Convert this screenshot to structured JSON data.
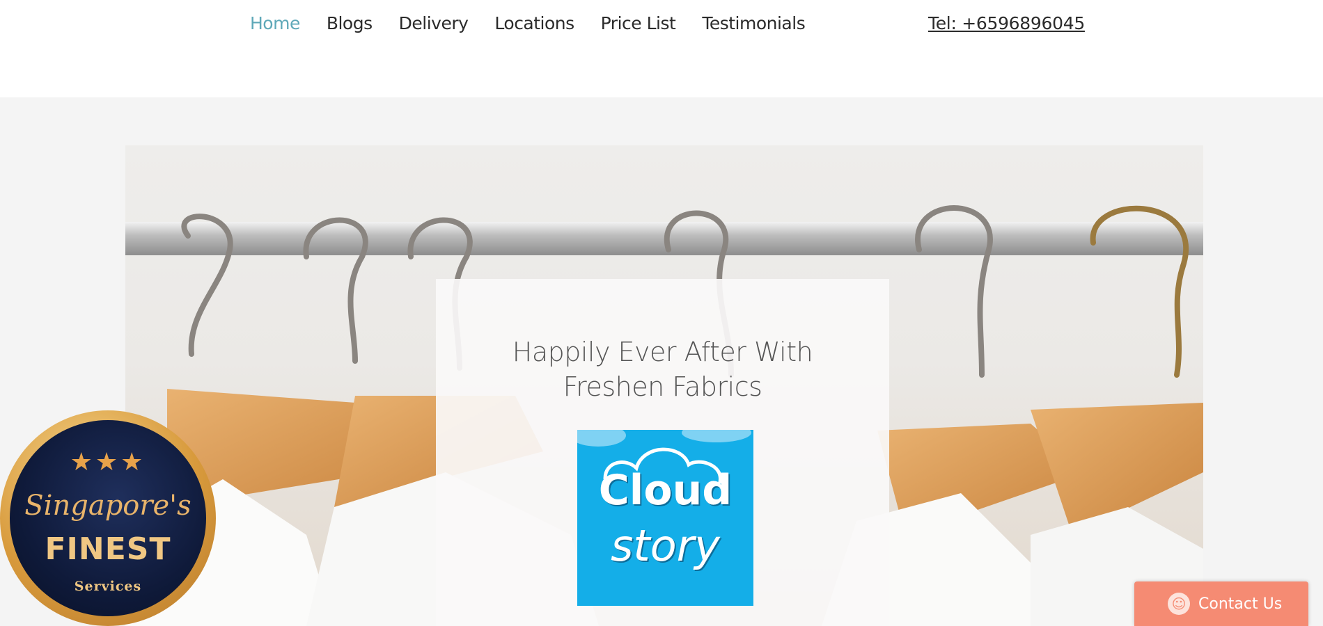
{
  "nav": {
    "items": [
      {
        "label": "Home",
        "active": true
      },
      {
        "label": "Blogs",
        "active": false
      },
      {
        "label": "Delivery",
        "active": false
      },
      {
        "label": "Locations",
        "active": false
      },
      {
        "label": "Price List",
        "active": false
      },
      {
        "label": "Testimonials",
        "active": false
      }
    ],
    "phone": "Tel: +6596896045"
  },
  "hero": {
    "title_line1": "Happily Ever After With",
    "title_line2": "Freshen Fabrics",
    "logo": {
      "line1": "Cloud",
      "line2": "story"
    }
  },
  "badge": {
    "stars": "★★★",
    "line1": "Singapore's",
    "line2": "FINEST",
    "line3": "Services"
  },
  "contact": {
    "label": "Contact Us",
    "icon": "smiley-icon"
  },
  "colors": {
    "accent": "#5ea8b8",
    "contact": "#f58b73",
    "logo_bg": "#14aee8"
  }
}
